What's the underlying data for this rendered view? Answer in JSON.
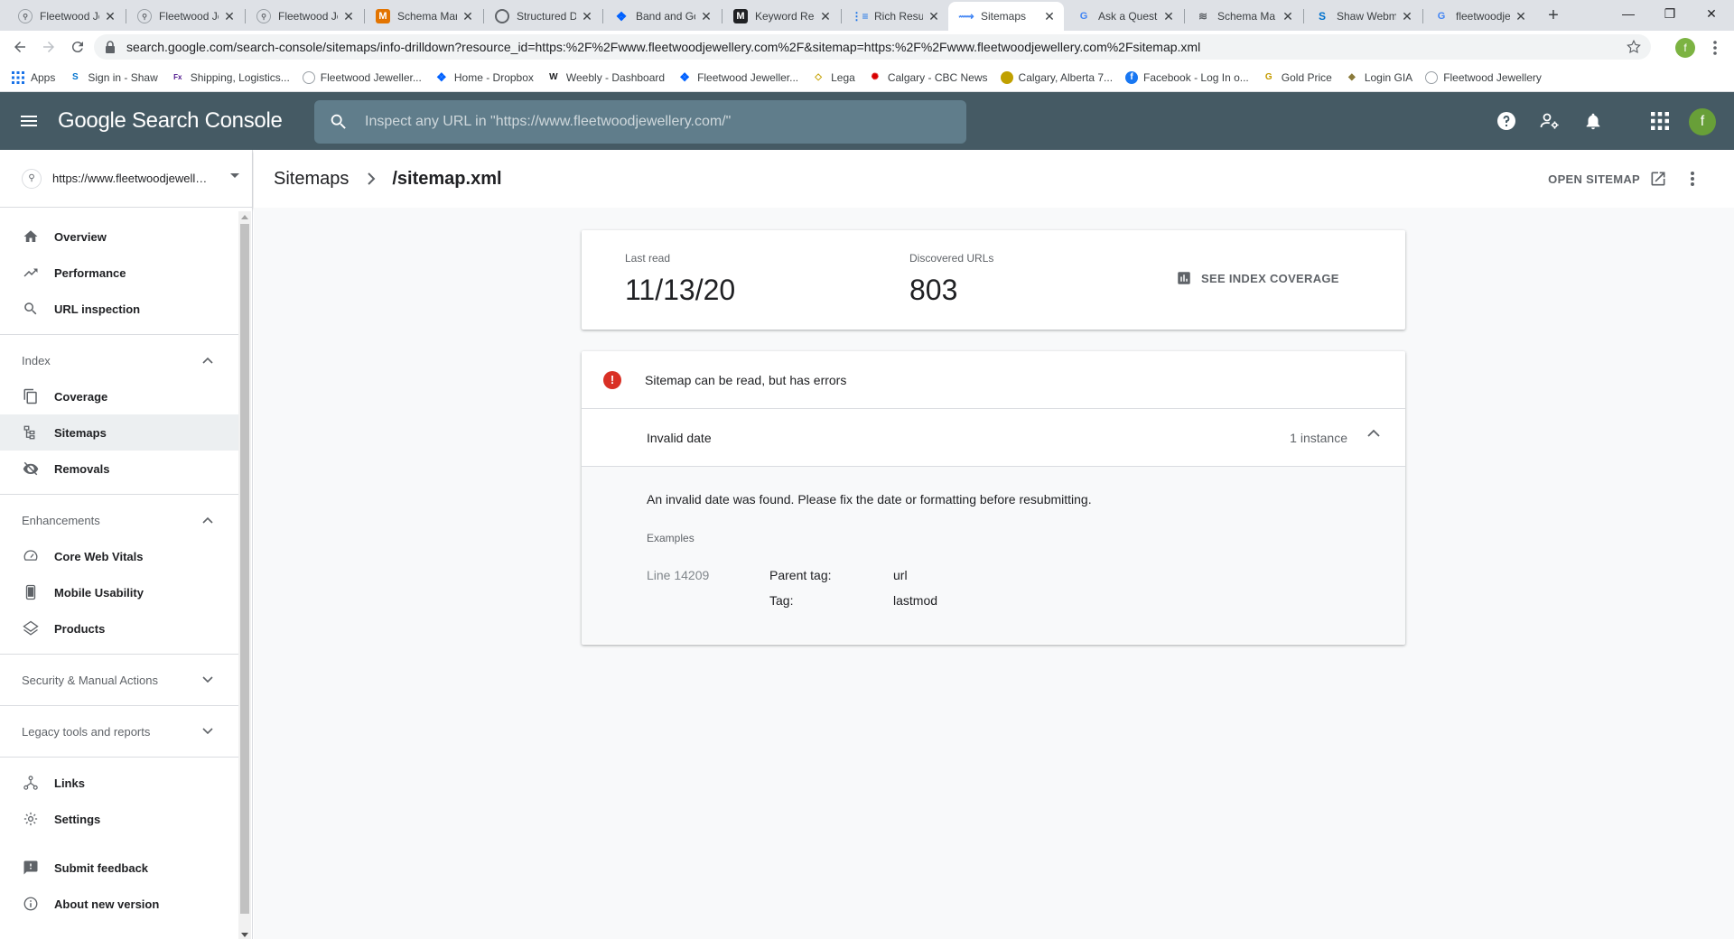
{
  "browser": {
    "tabs": [
      {
        "label": "Fleetwood Je",
        "icon": "fleetwood-favicon",
        "active": false
      },
      {
        "label": "Fleetwood Je",
        "icon": "fleetwood-favicon",
        "active": false
      },
      {
        "label": "Fleetwood Je",
        "icon": "fleetwood-favicon",
        "active": false
      },
      {
        "label": "Schema Mar",
        "icon": "m-favicon",
        "active": false
      },
      {
        "label": "Structured D",
        "icon": "globe-favicon",
        "active": false
      },
      {
        "label": "Band and Go",
        "icon": "dropbox-favicon",
        "active": false
      },
      {
        "label": "Keyword Res",
        "icon": "m-favicon",
        "active": false
      },
      {
        "label": "Rich Results",
        "icon": "rich-results-favicon",
        "active": false
      },
      {
        "label": "Sitemaps",
        "icon": "search-console-favicon",
        "active": true
      },
      {
        "label": "Ask a Questi",
        "icon": "google-favicon",
        "active": false
      },
      {
        "label": "Schema Ma",
        "icon": "schema-favicon",
        "active": false
      },
      {
        "label": "Shaw Webm",
        "icon": "shaw-favicon",
        "active": false
      },
      {
        "label": "fleetwoodjew",
        "icon": "google-favicon",
        "active": false
      }
    ],
    "url": "search.google.com/search-console/sitemaps/info-drilldown?resource_id=https:%2F%2Fwww.fleetwoodjewellery.com%2F&sitemap=https:%2F%2Fwww.fleetwoodjewellery.com%2Fsitemap.xml",
    "profile_initial": "f",
    "bookmarks": [
      {
        "label": "Apps",
        "icon": "apps-grid-icon"
      },
      {
        "label": "Sign in - Shaw",
        "icon": "shaw-favicon"
      },
      {
        "label": "Shipping, Logistics...",
        "icon": "fedex-favicon"
      },
      {
        "label": "Fleetwood Jeweller...",
        "icon": "fleetwood-favicon"
      },
      {
        "label": "Home - Dropbox",
        "icon": "dropbox-favicon"
      },
      {
        "label": "Weebly - Dashboard",
        "icon": "weebly-favicon"
      },
      {
        "label": "Fleetwood Jeweller...",
        "icon": "dropbox-favicon"
      },
      {
        "label": "Lega",
        "icon": "lega-favicon"
      },
      {
        "label": "Calgary - CBC News",
        "icon": "cbc-favicon"
      },
      {
        "label": "Calgary, Alberta 7...",
        "icon": "weather-favicon"
      },
      {
        "label": "Facebook - Log In o...",
        "icon": "facebook-favicon"
      },
      {
        "label": "Gold Price",
        "icon": "gold-favicon"
      },
      {
        "label": "Login GIA",
        "icon": "gia-favicon"
      },
      {
        "label": "Fleetwood Jewellery",
        "icon": "fleetwood-favicon"
      }
    ]
  },
  "header": {
    "brand": "Google Search Console",
    "search_placeholder": "Inspect any URL in \"https://www.fleetwoodjewellery.com/\"",
    "avatar_initial": "f",
    "colors": {
      "bar": "#455a64",
      "search": "#607d8b"
    }
  },
  "sidebar": {
    "property": "https://www.fleetwoodjewellery.com/",
    "top_items": [
      {
        "label": "Overview",
        "icon": "home-icon"
      },
      {
        "label": "Performance",
        "icon": "trending-up-icon"
      },
      {
        "label": "URL inspection",
        "icon": "search-icon"
      }
    ],
    "index_section": "Index",
    "index_items": [
      {
        "label": "Coverage",
        "icon": "file-copy-icon"
      },
      {
        "label": "Sitemaps",
        "icon": "sitemap-icon",
        "active": true
      },
      {
        "label": "Removals",
        "icon": "visibility-off-icon"
      }
    ],
    "enhancements_section": "Enhancements",
    "enhancements_items": [
      {
        "label": "Core Web Vitals",
        "icon": "speed-icon"
      },
      {
        "label": "Mobile Usability",
        "icon": "smartphone-icon"
      },
      {
        "label": "Products",
        "icon": "layers-icon"
      }
    ],
    "security_section": "Security & Manual Actions",
    "legacy_section": "Legacy tools and reports",
    "bottom_items": [
      {
        "label": "Links",
        "icon": "links-icon"
      },
      {
        "label": "Settings",
        "icon": "settings-icon"
      }
    ],
    "footer_items": [
      {
        "label": "Submit feedback",
        "icon": "feedback-icon"
      },
      {
        "label": "About new version",
        "icon": "info-icon"
      }
    ]
  },
  "page": {
    "breadcrumb_root": "Sitemaps",
    "breadcrumb_current": "/sitemap.xml",
    "open_sitemap": "OPEN SITEMAP"
  },
  "stats": {
    "last_read_label": "Last read",
    "last_read_value": "11/13/20",
    "discovered_label": "Discovered URLs",
    "discovered_value": "803",
    "see_coverage": "SEE INDEX COVERAGE"
  },
  "error": {
    "status": "Sitemap can be read, but has errors",
    "status_color": "#d93025",
    "issue_title": "Invalid date",
    "issue_count": "1 instance",
    "description": "An invalid date was found. Please fix the date or formatting before resubmitting.",
    "examples_label": "Examples",
    "example": {
      "line": "Line 14209",
      "parent_tag_label": "Parent tag:",
      "parent_tag_value": "url",
      "tag_label": "Tag:",
      "tag_value": "lastmod"
    }
  }
}
